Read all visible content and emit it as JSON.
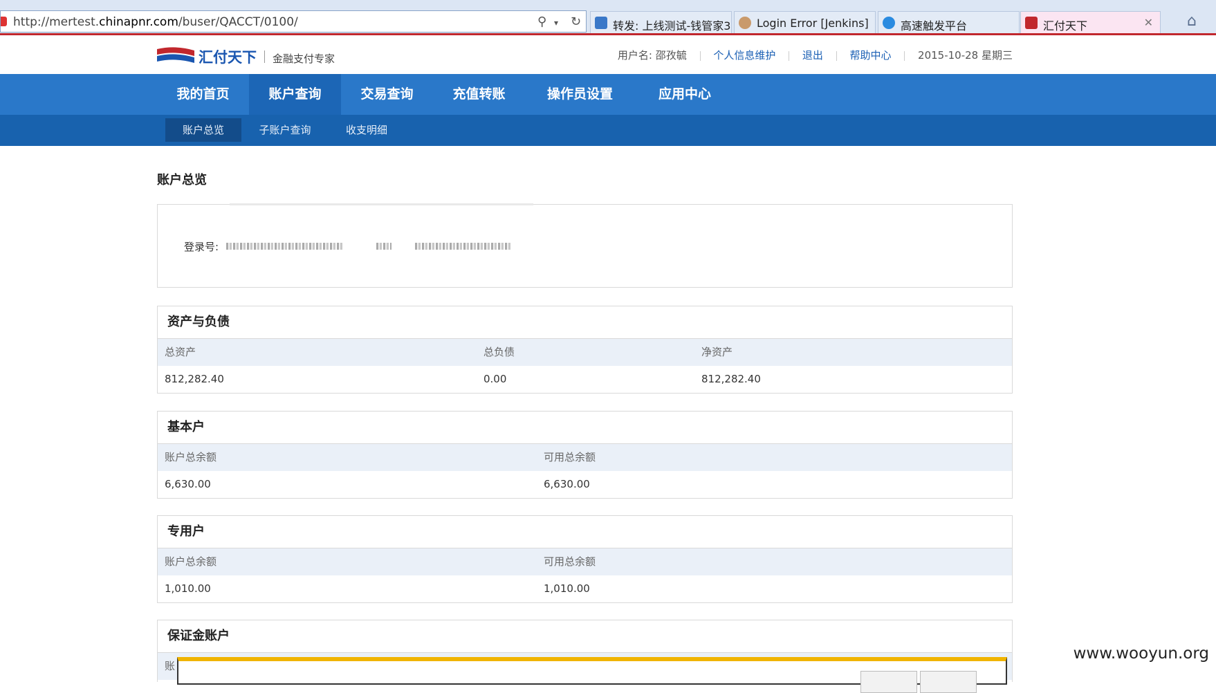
{
  "browser": {
    "url_prefix": "http://mertest.",
    "url_domain": "chinapnr.com",
    "url_path": "/buser/QACCT/0100/",
    "tabs": [
      {
        "label": "转发: 上线测试-钱管家3...",
        "color": "#3a78c8"
      },
      {
        "label": "Login Error [Jenkins]",
        "color": "#c99a6b"
      },
      {
        "label": "高速触发平台",
        "color": "#2a8be0"
      },
      {
        "label": "汇付天下",
        "color": "#c1272d"
      }
    ]
  },
  "header": {
    "logo_name": "汇付天下",
    "logo_slogan": "金融支付专家",
    "user_label": "用户名: 邵孜毓",
    "links": [
      "个人信息维护",
      "退出",
      "帮助中心"
    ],
    "date": "2015-10-28 星期三"
  },
  "nav": {
    "items": [
      "我的首页",
      "账户查询",
      "交易查询",
      "充值转账",
      "操作员设置",
      "应用中心"
    ],
    "sub_items": [
      "账户总览",
      "子账户查询",
      "收支明细"
    ]
  },
  "page": {
    "title": "账户总览",
    "login_label": "登录号:"
  },
  "assets": {
    "title": "资产与负债",
    "headers": [
      "总资产",
      "总负债",
      "净资产"
    ],
    "values": [
      "812,282.40",
      "0.00",
      "812,282.40"
    ]
  },
  "basic": {
    "title": "基本户",
    "headers": [
      "账户总余额",
      "可用总余额"
    ],
    "values": [
      "6,630.00",
      "6,630.00"
    ]
  },
  "special": {
    "title": "专用户",
    "headers": [
      "账户总余额",
      "可用总余额"
    ],
    "values": [
      "1,010.00",
      "1,010.00"
    ]
  },
  "margin": {
    "title": "保证金账户",
    "partial_label": "账"
  },
  "watermark": "www.wooyun.org"
}
